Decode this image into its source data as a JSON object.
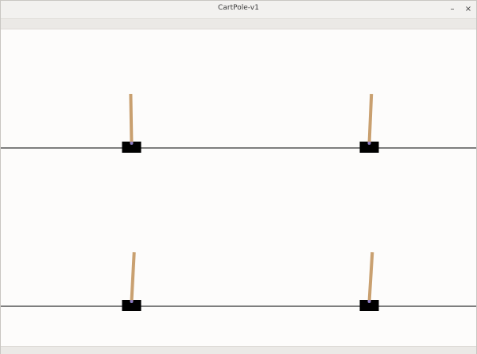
{
  "window": {
    "title": "CartPole-v1",
    "minimize_glyph": "–",
    "close_glyph": "×"
  },
  "environments": [
    {
      "cart_position": 0.0,
      "pole_angle_deg": -1.0
    },
    {
      "cart_position": 0.0,
      "pole_angle_deg": 2.5
    },
    {
      "cart_position": 0.0,
      "pole_angle_deg": 3.0
    },
    {
      "cart_position": 0.0,
      "pole_angle_deg": 3.5
    }
  ],
  "colors": {
    "track": "#000000",
    "cart": "#000000",
    "pole": "#c9a070",
    "axle": "#8c7cc4",
    "background": "#fdfcfb"
  }
}
